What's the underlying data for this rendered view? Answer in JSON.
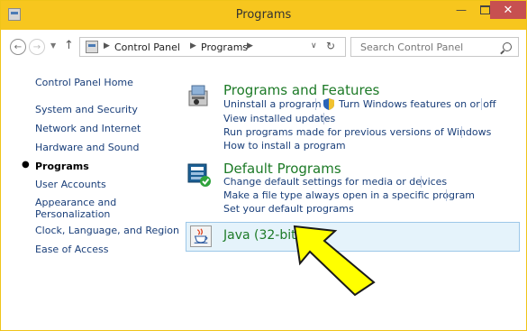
{
  "window": {
    "title": "Programs"
  },
  "address": {
    "crumbs": [
      "Control Panel",
      "Programs"
    ],
    "search_placeholder": "Search Control Panel"
  },
  "sidebar": {
    "items": [
      "Control Panel Home",
      "System and Security",
      "Network and Internet",
      "Hardware and Sound",
      "Programs",
      "User Accounts",
      "Appearance and",
      "Personalization",
      "Clock, Language, and Region",
      "Ease of Access"
    ]
  },
  "categories": [
    {
      "title": "Programs and Features",
      "links": [
        "Uninstall a program",
        "Turn Windows features on or off",
        "View installed updates",
        "Run programs made for previous versions of Windows",
        "How to install a program"
      ]
    },
    {
      "title": "Default Programs",
      "links": [
        "Change default settings for media or devices",
        "Make a file type always open in a specific program",
        "Set your default programs"
      ]
    },
    {
      "title": "Java (32-bit)"
    }
  ],
  "colors": {
    "titlebar": "#f7c61e",
    "link": "#1a3f7a",
    "category_title": "#1d7a27",
    "highlight": "#e5f3fb",
    "callout_arrow": "#ffff00"
  },
  "icons": {
    "close": "close-icon",
    "minimize": "minimize-icon",
    "maximize": "maximize-icon",
    "back": "back-arrow-icon",
    "forward": "forward-arrow-icon",
    "up": "up-arrow-icon",
    "refresh": "refresh-icon",
    "search": "search-icon",
    "shield": "shield-icon",
    "java": "java-icon"
  }
}
